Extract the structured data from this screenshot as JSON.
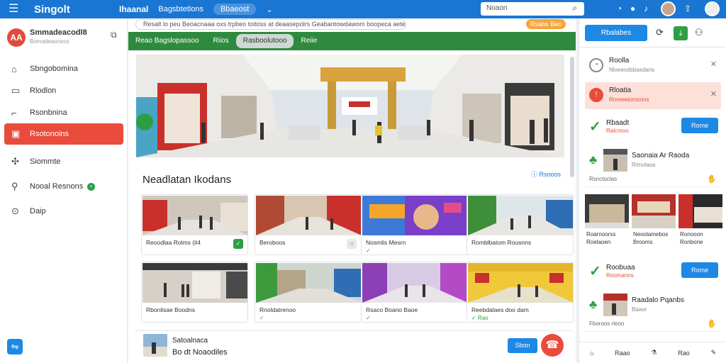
{
  "topbar": {
    "brand": "Singolt",
    "nav_title": "Ihaanal",
    "nav_item": "Bagsbtetlons",
    "nav_pill": "Bbaeost",
    "search_placeholder": "Noaon"
  },
  "sidebar": {
    "logo_text": "AA",
    "title": "Smmadeacodl8",
    "subtitle": "Bomadeaonocs",
    "items": [
      {
        "label": "Sbngobomina",
        "icon": "home-icon"
      },
      {
        "label": "Rlodlon",
        "icon": "monitor-icon"
      },
      {
        "label": "Rsonbnina",
        "icon": "chart-icon"
      },
      {
        "label": "Rsotonoins",
        "icon": "tag-icon"
      },
      {
        "label": "Siommte",
        "icon": "users-icon"
      },
      {
        "label": "Nooal Resnons",
        "icon": "person-icon",
        "badge": "+"
      },
      {
        "label": "Daip",
        "icon": "help-icon"
      }
    ]
  },
  "main": {
    "hint_text": "Resalt lo peu Beoacnaaa oxs  trpbeo toitoss at  deaasepolrs Geabantowdawom boopeca aetem",
    "hint_button": "Rsabs Beo",
    "tabs": [
      "Reao Bagslopassoo",
      "Riios",
      "Rasboolutooo",
      "Reiie"
    ],
    "section_title": "Neadlatan Ikodans",
    "section_link": "Rsooos",
    "cards": [
      {
        "cap": "Reoodlaa Rolms (it4",
        "cap2": "",
        "badge": "✓"
      },
      {
        "cap": "Beroboos",
        "cap2": "",
        "badge": "○",
        "grey": true
      },
      {
        "cap": "Nosmlis Mesrn",
        "cap2": "✓",
        "badge": ""
      },
      {
        "cap": "Romblbatom Rousnns",
        "cap2": "",
        "badge": ""
      },
      {
        "cap": "Rbonlisae Boodns",
        "cap2": "",
        "badge": ""
      },
      {
        "cap": "Rnoldatrenoo",
        "cap2": "✓",
        "badge": ""
      },
      {
        "cap": "Rsaco Boano Baoe",
        "cap2": "✓",
        "badge": ""
      },
      {
        "cap": "Reebdalaes doo dam",
        "cap2": "✓ Rao",
        "badge": ""
      }
    ],
    "bottom": {
      "title": "Satoalnaca",
      "subtitle": "Bo dt Noaodiles",
      "button": "Sbon",
      "fab": "☎"
    }
  },
  "right": {
    "top_button": "Rbalabes",
    "notifs": [
      {
        "title": "Roolla",
        "sub": "Nloeeodsbasdans",
        "red": false
      },
      {
        "title": "Rloatia",
        "sub": "Rnreeeiorosons",
        "red": true
      }
    ],
    "act1": {
      "title": "Rbaadt",
      "sub": "Ralcmoo",
      "button": "Rome"
    },
    "feed1": {
      "title": "Saonaia  Ar  Raoda",
      "sub": "Rimolasa",
      "foot": "Rsnctoclas"
    },
    "gallery": [
      "Roarnoorss",
      "Neoolamebos",
      "Ronooon",
      "Roelaoen",
      "Brooms",
      "Ronbone"
    ],
    "act2": {
      "title": "Roobuaa",
      "sub": "Roomanns",
      "button": "Rome"
    },
    "feed2": {
      "title": "Raadalo  Pqanbs",
      "sub": "Baaor",
      "foot": "Fboroos rleoo"
    },
    "footer": [
      "Raao",
      "Rao"
    ]
  }
}
